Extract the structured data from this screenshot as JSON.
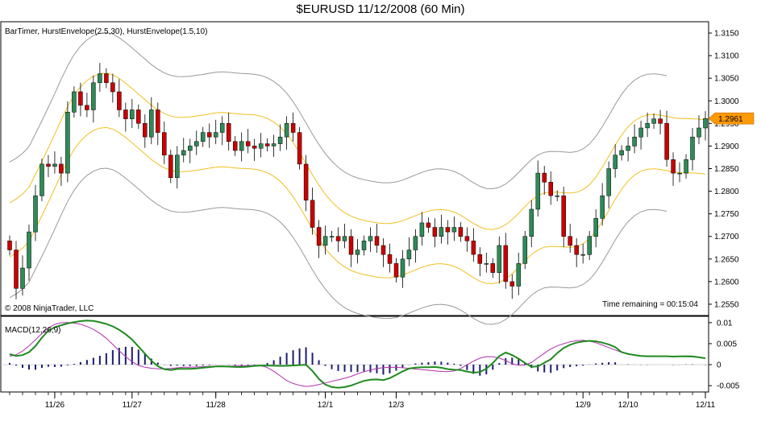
{
  "chart_data": {
    "type": "candlestick",
    "title": "$EURUSD  11/12/2008 (60 Min)",
    "indicators_label": "BarTimer, HurstEnvelope(2.5,30), HurstEnvelope(1.5,10)",
    "copyright": "© 2008 NinjaTrader, LLC",
    "time_remaining": "Time remaining = 00:15:04",
    "last_price_label": "1.2961",
    "price_ticks": [
      "1.3150",
      "1.3100",
      "1.3050",
      "1.3000",
      "1.2950",
      "1.2900",
      "1.2850",
      "1.2800",
      "1.2750",
      "1.2700",
      "1.2650",
      "1.2600",
      "1.2550"
    ],
    "price_tick_values": [
      1.315,
      1.31,
      1.305,
      1.3,
      1.295,
      1.29,
      1.285,
      1.28,
      1.275,
      1.27,
      1.265,
      1.26,
      1.255
    ],
    "price_range": [
      1.2525,
      1.3175
    ],
    "x_labels": [
      "11/26",
      "11/27",
      "11/28",
      "12/1",
      "12/3",
      "12/9",
      "12/10",
      "12/11"
    ],
    "x_label_bars": [
      7,
      19,
      32,
      49,
      60,
      89,
      96,
      108
    ],
    "bar_count": 109,
    "closes": [
      1.267,
      1.2585,
      1.263,
      1.271,
      1.279,
      1.286,
      1.2855,
      1.286,
      1.284,
      1.2975,
      1.302,
      1.299,
      1.298,
      1.304,
      1.306,
      1.304,
      1.302,
      1.298,
      1.296,
      1.298,
      1.295,
      1.292,
      1.298,
      1.293,
      1.288,
      1.283,
      1.288,
      1.289,
      1.29,
      1.291,
      1.293,
      1.292,
      1.293,
      1.295,
      1.291,
      1.289,
      1.291,
      1.29,
      1.2895,
      1.2905,
      1.29,
      1.2905,
      1.292,
      1.295,
      1.293,
      1.286,
      1.278,
      1.272,
      1.268,
      1.27,
      1.27,
      1.269,
      1.27,
      1.266,
      1.267,
      1.269,
      1.27,
      1.268,
      1.266,
      1.264,
      1.261,
      1.265,
      1.267,
      1.27,
      1.273,
      1.272,
      1.27,
      1.272,
      1.271,
      1.272,
      1.27,
      1.269,
      1.266,
      1.264,
      1.264,
      1.262,
      1.268,
      1.26,
      1.259,
      1.264,
      1.27,
      1.276,
      1.284,
      1.282,
      1.279,
      1.279,
      1.27,
      1.268,
      1.266,
      1.266,
      1.27,
      1.274,
      1.279,
      1.285,
      1.288,
      1.289,
      1.29,
      1.292,
      1.294,
      1.295,
      1.296,
      1.295,
      1.287,
      1.284,
      1.284,
      1.287,
      1.292,
      1.294,
      1.2961
    ],
    "macd": {
      "label": "MACD(12,26,9)",
      "ticks": [
        "0.01",
        "0.005",
        "0",
        "-0.005"
      ],
      "tick_values": [
        0.01,
        0.005,
        0,
        -0.005
      ],
      "range": [
        -0.0065,
        0.0115
      ],
      "macd_line": [
        0.0025,
        0.002,
        0.0024,
        0.0035,
        0.006,
        0.008,
        0.009,
        0.0095,
        0.01,
        0.0103,
        0.0105,
        0.0104,
        0.01,
        0.0095,
        0.0087,
        0.0075,
        0.006,
        0.004,
        0.002,
        0.0,
        -0.001,
        -0.0013,
        -0.001,
        -0.001,
        -0.001,
        -0.0008,
        -0.0006,
        -0.0004,
        -0.0004,
        -0.0005,
        -0.0006,
        -0.0005,
        -0.0003,
        -0.0002,
        -0.0002,
        -0.0003,
        -0.0003,
        -0.0002,
        -0.0001,
        0.0,
        -0.0025,
        -0.0045,
        -0.0053,
        -0.0055,
        -0.0053,
        -0.0048,
        -0.004,
        -0.0036,
        -0.0035,
        -0.0037,
        -0.003,
        -0.002,
        -0.001,
        -0.0007,
        -0.0006,
        -0.0006,
        -0.0005,
        -0.001,
        -0.0012,
        -0.0013,
        -0.0017,
        -0.002,
        -0.0015,
        0.0,
        0.002,
        0.003,
        0.002,
        0.001,
        -0.0005,
        -0.0005,
        0.0005,
        0.0015,
        0.0035,
        0.0045,
        0.0052,
        0.0055,
        0.0057,
        0.0055,
        0.005,
        0.0045,
        0.003,
        0.0025,
        0.0022,
        0.002,
        0.002,
        0.002,
        0.002,
        0.0019,
        0.002,
        0.002,
        0.0018,
        0.0015
      ],
      "signal_line": [
        0.002,
        0.0025,
        0.004,
        0.006,
        0.008,
        0.0095,
        0.01,
        0.01,
        0.0097,
        0.009,
        0.008,
        0.0065,
        0.0045,
        0.0025,
        0.0008,
        -0.0004,
        -0.0008,
        -0.001,
        -0.001,
        -0.0008,
        -0.0006,
        -0.0006,
        -0.0005,
        -0.0004,
        -0.0004,
        -0.0004,
        -0.0003,
        -0.0003,
        -0.0002,
        -0.0002,
        -0.001,
        -0.0025,
        -0.004,
        -0.0048,
        -0.0052,
        -0.005,
        -0.0045,
        -0.004,
        -0.0035,
        -0.003,
        -0.0022,
        -0.0015,
        -0.001,
        -0.0007,
        -0.0006,
        -0.0007,
        -0.0009,
        -0.0011,
        -0.0013,
        -0.0015,
        -0.0017,
        -0.0016,
        -0.0008,
        0.0005,
        0.0015,
        0.002,
        0.0018,
        0.001,
        0.0,
        -0.0003,
        0.0005,
        0.002,
        0.0035,
        0.0045,
        0.0052,
        0.0057,
        0.0058,
        0.0055,
        0.0048,
        0.004,
        0.0032,
        0.0025,
        0.0022,
        0.0021,
        0.002,
        0.002,
        0.002,
        0.002,
        0.0019,
        0.0018,
        0.0016
      ]
    },
    "colors": {
      "up": "#2e8b57",
      "down": "#cc0000",
      "outer_envelope": "#999999",
      "inner_envelope": "#f0c020",
      "macd_line": "#1e8a1e",
      "signal_line": "#b030b0",
      "histogram": "#1c1c6e",
      "price_marker": "#ff9900"
    }
  }
}
